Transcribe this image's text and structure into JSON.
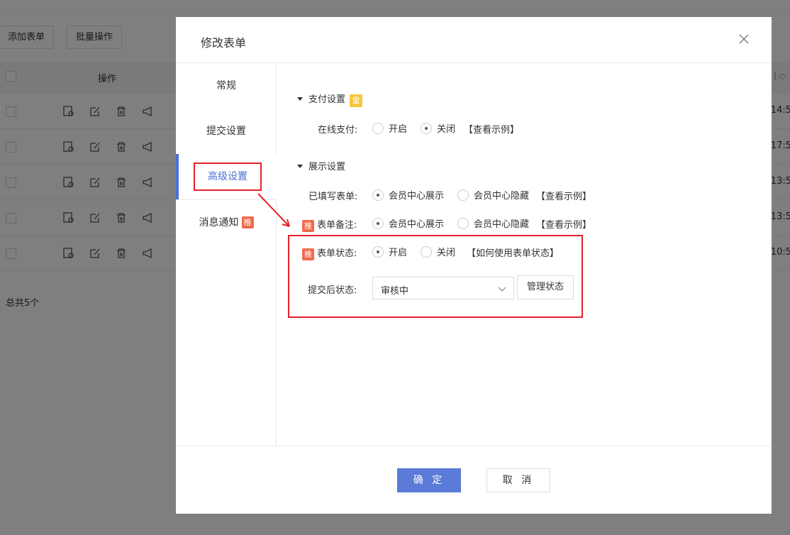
{
  "background": {
    "add_form_label": "添加表单",
    "batch_label": "批量操作",
    "col_operation": "操作",
    "rows": [
      {
        "time": "14:5"
      },
      {
        "time": "17:5"
      },
      {
        "time": "13:5"
      },
      {
        "time": "13:5"
      },
      {
        "time": "10:5"
      }
    ],
    "total": "总共5个"
  },
  "modal": {
    "title": "修改表单",
    "sidebar": {
      "items": [
        {
          "label": "常规"
        },
        {
          "label": "提交设置"
        },
        {
          "label": "高级设置"
        },
        {
          "label": "消息通知",
          "badge": "推"
        }
      ]
    },
    "payment": {
      "title": "支付设置",
      "badge": "皇",
      "online_label": "在线支付:",
      "opt_on": "开启",
      "opt_off": "关闭",
      "example": "【查看示例】"
    },
    "display": {
      "title": "展示设置",
      "filled_label": "已填写表单:",
      "filled_opt1": "会员中心展示",
      "filled_opt2": "会员中心隐藏",
      "filled_example": "【查看示例】",
      "note_badge": "推",
      "note_label": "表单备注:",
      "note_opt1": "会员中心展示",
      "note_opt2": "会员中心隐藏",
      "note_example": "【查看示例】",
      "status_badge": "推",
      "status_label": "表单状态:",
      "status_on": "开启",
      "status_off": "关闭",
      "status_help": "【如何使用表单状态】",
      "after_submit_label": "提交后状态:",
      "after_submit_value": "审核中",
      "manage_label": "管理状态"
    },
    "footer": {
      "ok_label": "确 定",
      "cancel_label": "取 消"
    }
  },
  "colors": {
    "accent": "#4a6fd6",
    "primary_button": "#5b7bd9",
    "highlight_red": "#e5202a",
    "push_badge": "#ee6b4d",
    "vip_badge": "#f7c640"
  }
}
